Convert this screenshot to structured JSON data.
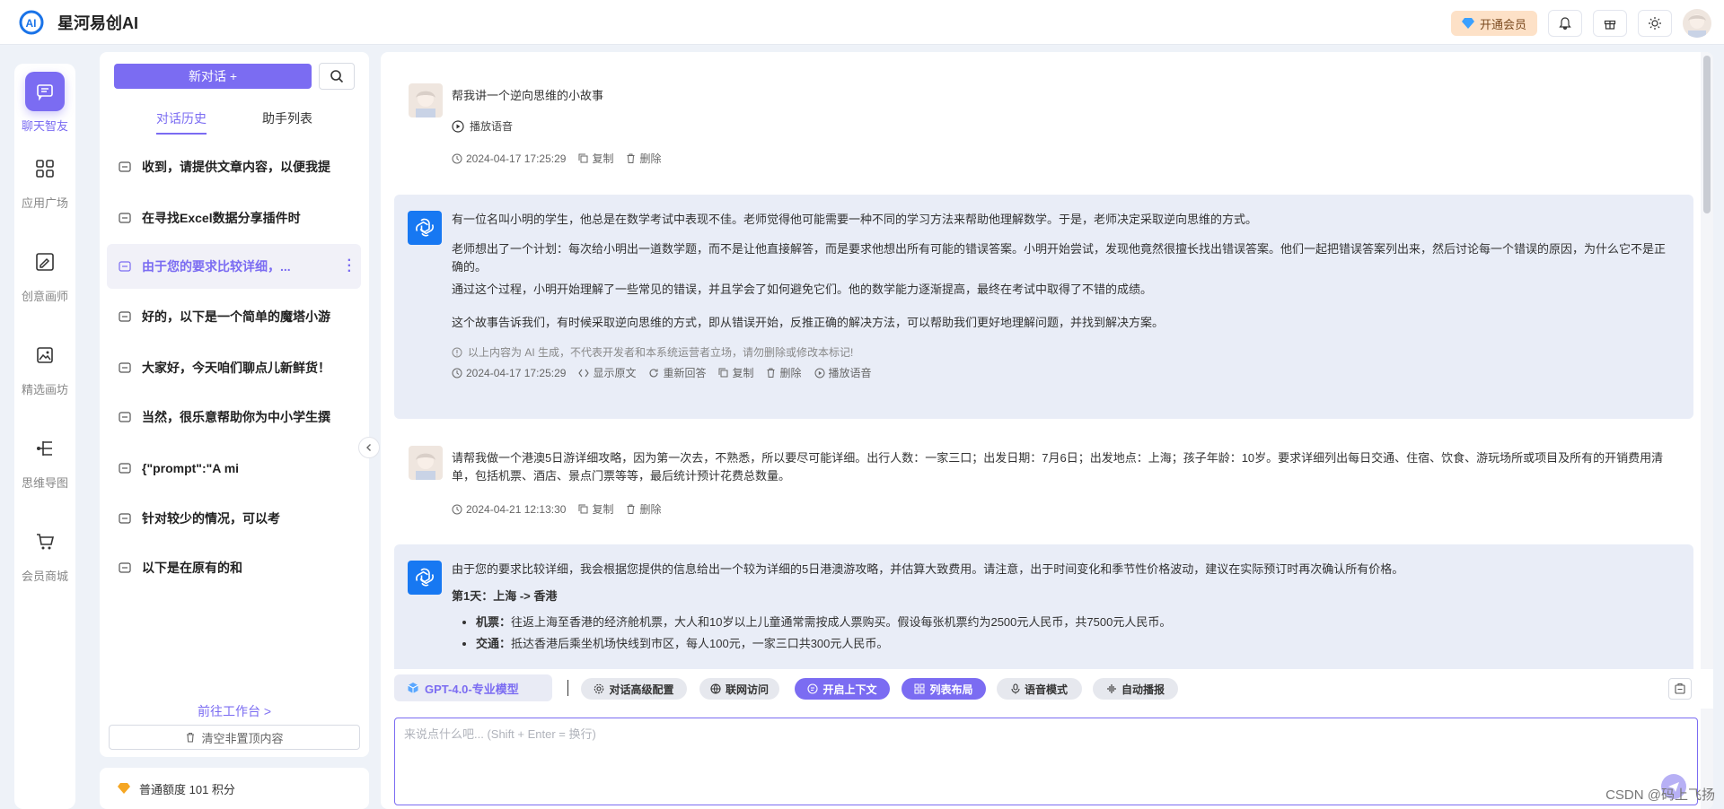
{
  "app": {
    "name": "星河易创AI"
  },
  "topbar": {
    "vip_label": "开通会员",
    "icons": [
      "bell-icon",
      "gift-icon",
      "sun-icon",
      "user-avatar"
    ]
  },
  "nav": {
    "items": [
      {
        "label": "聊天智友",
        "icon": "chat-icon",
        "active": true
      },
      {
        "label": "应用广场",
        "icon": "grid-icon"
      },
      {
        "label": "创意画师",
        "icon": "draw-icon"
      },
      {
        "label": "精选画坊",
        "icon": "gallery-icon"
      },
      {
        "label": "思维导图",
        "icon": "mindmap-icon"
      },
      {
        "label": "会员商城",
        "icon": "cart-icon"
      }
    ]
  },
  "sidebar": {
    "new_chat_label": "新对话 +",
    "tabs": [
      {
        "label": "对话历史",
        "active": true
      },
      {
        "label": "助手列表"
      }
    ],
    "conversations": [
      {
        "title": "收到，请提供文章内容，以便我提"
      },
      {
        "title": "在寻找Excel数据分享插件时"
      },
      {
        "title": "由于您的要求比较详细，...",
        "active": true
      },
      {
        "title": "好的，以下是一个简单的魔塔小游"
      },
      {
        "title": "大家好，今天咱们聊点儿新鲜货！"
      },
      {
        "title": "当然，很乐意帮助你为中小学生撰"
      },
      {
        "title": "{\"prompt\":\"A mi"
      },
      {
        "title": "针对较少的情况，可以考"
      },
      {
        "title": "以下是在原有的和"
      }
    ],
    "goto_workbench": "前往工作台 >",
    "clear_label": "清空非置顶内容",
    "quota_label": "普通额度 101 积分"
  },
  "chat": {
    "messages": [
      {
        "role": "user",
        "text": "帮我讲一个逆向思维的小故事",
        "play_voice": "播放语音",
        "time": "2024-04-17 17:25:29",
        "actions": [
          "复制",
          "删除"
        ]
      },
      {
        "role": "ai",
        "paragraphs": [
          "有一位名叫小明的学生，他总是在数学考试中表现不佳。老师觉得他可能需要一种不同的学习方法来帮助他理解数学。于是，老师决定采取逆向思维的方式。",
          "老师想出了一个计划：每次给小明出一道数学题，而不是让他直接解答，而是要求他想出所有可能的错误答案。小明开始尝试，发现他竟然很擅长找出错误答案。他们一起把错误答案列出来，然后讨论每一个错误的原因，为什么它不是正确的。",
          "通过这个过程，小明开始理解了一些常见的错误，并且学会了如何避免它们。他的数学能力逐渐提高，最终在考试中取得了不错的成绩。",
          "这个故事告诉我们，有时候采取逆向思维的方式，即从错误开始，反推正确的解决方法，可以帮助我们更好地理解问题，并找到解决方案。"
        ],
        "disclaimer": "以上内容为 AI 生成，不代表开发者和本系统运营者立场，请勿删除或修改本标记!",
        "time": "2024-04-17 17:25:29",
        "actions": [
          "显示原文",
          "重新回答",
          "复制",
          "删除",
          "播放语音"
        ]
      },
      {
        "role": "user",
        "text": "请帮我做一个港澳5日游详细攻略，因为第一次去，不熟悉，所以要尽可能详细。出行人数：一家三口；出发日期：7月6日；出发地点：上海；孩子年龄：10岁。要求详细列出每日交通、住宿、饮食、游玩场所或项目及所有的开销费用清单，包括机票、酒店、景点门票等等，最后统计预计花费总数量。",
        "time": "2024-04-21 12:13:30",
        "actions": [
          "复制",
          "删除"
        ]
      },
      {
        "role": "ai",
        "intro": "由于您的要求比较详细，我会根据您提供的信息给出一个较为详细的5日港澳游攻略，并估算大致费用。请注意，出于时间变化和季节性价格波动，建议在实际预订时再次确认所有价格。",
        "day1_title": "第1天：上海 -> 香港",
        "items": [
          {
            "label": "机票：",
            "text": "往返上海至香港的经济舱机票，大人和10岁以上儿童通常需按成人票购买。假设每张机票约为2500元人民币，共7500元人民币。"
          },
          {
            "label": "交通：",
            "text": "抵达香港后乘坐机场快线到市区，每人100元，一家三口共300元人民币。"
          }
        ]
      }
    ]
  },
  "toolbar": {
    "model_label": "GPT-4.0-专业模型",
    "buttons": [
      {
        "label": "对话高级配置",
        "icon": "settings-icon",
        "active": false
      },
      {
        "label": "联网访问",
        "icon": "globe-icon",
        "active": false
      },
      {
        "label": "开启上下文",
        "icon": "context-icon",
        "active": true
      },
      {
        "label": "列表布局",
        "icon": "layout-icon",
        "active": true
      },
      {
        "label": "语音模式",
        "icon": "mic-icon",
        "active": false
      },
      {
        "label": "自动播报",
        "icon": "wave-icon",
        "active": false
      }
    ]
  },
  "input": {
    "placeholder": "来说点什么吧... (Shift + Enter = 换行)"
  },
  "watermark": "CSDN @码上飞扬",
  "colors": {
    "accent": "#7b6cf2",
    "ai_bg": "#e9edf7",
    "gpt_blue": "#1778f2",
    "vip_bg": "#fde1c7"
  }
}
